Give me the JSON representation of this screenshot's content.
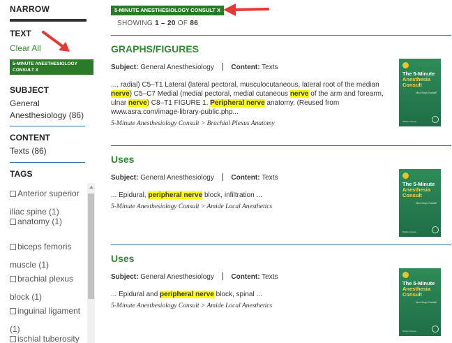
{
  "sidebar": {
    "narrow_title": "NARROW",
    "text_title": "TEXT",
    "clear_all": "Clear All",
    "active_chip": "5-MINUTE ANESTHESIOLOGY CONSULT  X",
    "subject_title": "SUBJECT",
    "subject_value": "General Anesthesiology (86)",
    "content_title": "CONTENT",
    "content_value": "Texts (86)",
    "tags_title": "TAGS",
    "tags": [
      "Anterior superior iliac spine (1)",
      "anatomy (1)",
      "biceps femoris muscle (1)",
      "brachial plexus block (1)",
      "inguinal ligament (1)",
      "ischial tuberosity"
    ]
  },
  "header": {
    "chip": "5-MINUTE ANESTHESIOLOGY CONSULT  X",
    "showing_label": "SHOWING",
    "range": "1 – 20",
    "of_label": "OF",
    "total": "86"
  },
  "results": [
    {
      "title": "GRAPHS/FIGURES",
      "subject_label": "Subject:",
      "subject": "General Anesthesiology",
      "content_label": "Content:",
      "content": "Texts",
      "snippet": [
        {
          "t": "..., radial) C5–T1 Lateral (lateral pectoral, musculocutaneous, lateral root of the median ",
          "h": false
        },
        {
          "t": "nerve",
          "h": true
        },
        {
          "t": ") C5–C7 Medial (medial pectoral, medial cutaneous ",
          "h": false
        },
        {
          "t": "nerve",
          "h": true
        },
        {
          "t": " of the arm and forearm, ulnar ",
          "h": false
        },
        {
          "t": "nerve",
          "h": true
        },
        {
          "t": ") C8–T1 FIGURE 1. ",
          "h": false
        },
        {
          "t": "Peripheral nerve",
          "h": true
        },
        {
          "t": " anatomy. (Reused from www.asra.com/image-library-public.php...",
          "h": false
        }
      ],
      "breadcrumb": "5-Minute Anesthesiology Consult > Brachial Plexus Anatomy"
    },
    {
      "title": "Uses",
      "subject_label": "Subject:",
      "subject": "General Anesthesiology",
      "content_label": "Content:",
      "content": "Texts",
      "snippet": [
        {
          "t": "... Epidural, ",
          "h": false
        },
        {
          "t": "peripheral nerve",
          "h": true
        },
        {
          "t": " block, infiltration ...",
          "h": false
        }
      ],
      "breadcrumb": "5-Minute Anesthesiology Consult > Amide Local Anesthetics"
    },
    {
      "title": "Uses",
      "subject_label": "Subject:",
      "subject": "General Anesthesiology",
      "content_label": "Content:",
      "content": "Texts",
      "snippet": [
        {
          "t": "... Epidural and ",
          "h": false
        },
        {
          "t": "peripheral nerve",
          "h": true
        },
        {
          "t": " block, spinal ...",
          "h": false
        }
      ],
      "breadcrumb": "5-Minute Anesthesiology Consult > Amide Local Anesthetics"
    }
  ],
  "book_cover": {
    "line1": "The 5-Minute",
    "line2": "Anesthesia",
    "line3": "Consult",
    "editors": "Nina Singh-Radcliff",
    "publisher": "Wolters Kluwer"
  },
  "colors": {
    "accent_green": "#2e8b2e",
    "chip_green": "#2a7a2a",
    "rule_blue": "#2c6fa3",
    "highlight": "#ffff00",
    "arrow_red": "#e53935"
  }
}
